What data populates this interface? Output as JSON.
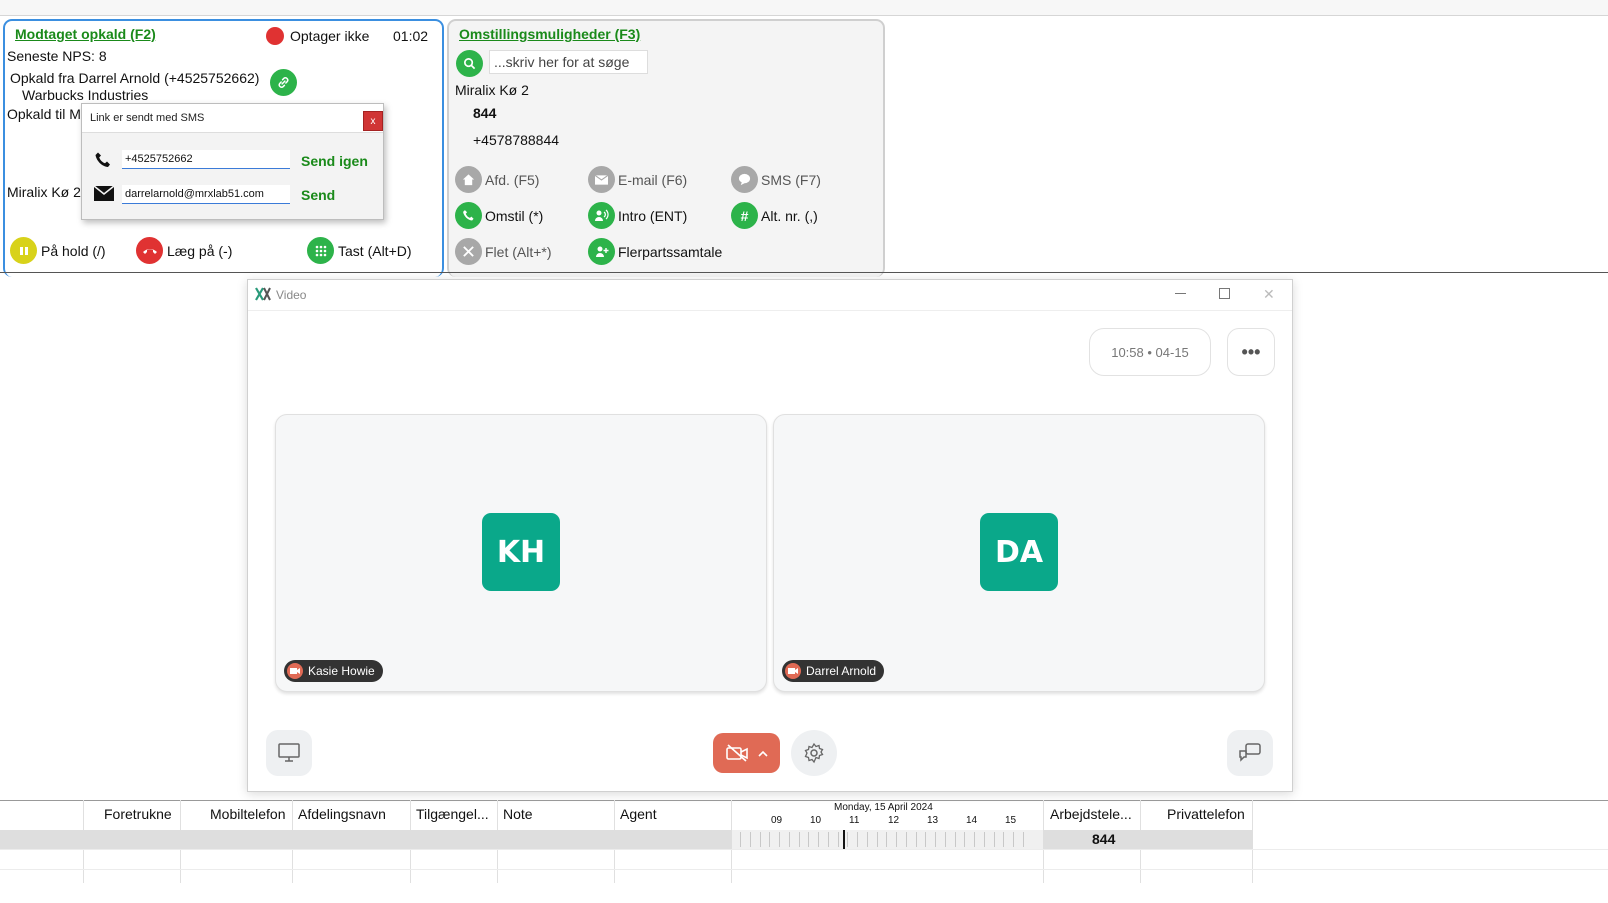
{
  "call_panel": {
    "title": "Modtaget opkald (F2)",
    "recording": "Optager ikke",
    "timer": "01:02",
    "nps": "Seneste NPS: 8",
    "caller": "Opkald fra Darrel Arnold (+4525752662)",
    "company": "Warbucks Industries",
    "call_to": "Opkald til Mi",
    "queue": "Miralix Kø 2",
    "actions": {
      "hold": "På hold (/)",
      "hangup": "Læg på (-)",
      "keypad": "Tast (Alt+D)"
    }
  },
  "sms_popup": {
    "title": "Link er sendt med SMS",
    "close": "x",
    "phone_value": "+4525752662",
    "resend": "Send igen",
    "email_value": "darrelarnold@mrxlab51.com",
    "send": "Send"
  },
  "transfer_panel": {
    "title": "Omstillingsmuligheder (F3)",
    "search_placeholder": "...skriv her for at søge",
    "queue": "Miralix Kø 2",
    "ext": "844",
    "number": "+4578788844",
    "buttons": {
      "afd": "Afd. (F5)",
      "email": "E-mail (F6)",
      "sms": "SMS (F7)",
      "omstil": "Omstil (*)",
      "intro": "Intro (ENT)",
      "altnr": "Alt. nr. (,)",
      "flet": "Flet (Alt+*)",
      "flerpart": "Flerpartssamtale"
    }
  },
  "video": {
    "window_title": "Video",
    "time_pill": "10:58  •  04-15",
    "participants": [
      {
        "initials": "KH",
        "name": "Kasie Howie"
      },
      {
        "initials": "DA",
        "name": "Darrel Arnold"
      }
    ],
    "colors": {
      "avatar": "#0aa88a",
      "cam_button": "#e06a55"
    }
  },
  "grid": {
    "headers": {
      "foretrukne": "Foretrukne",
      "mobil": "Mobiltelefon",
      "afdeling": "Afdelingsnavn",
      "tilg": "Tilgængel...",
      "note": "Note",
      "agent": "Agent",
      "date": "Monday, 15 April 2024",
      "arbejde": "Arbejdstele...",
      "privat": "Privattelefon"
    },
    "hours": [
      "09",
      "10",
      "11",
      "12",
      "13",
      "14",
      "15"
    ],
    "row_value": "844"
  }
}
